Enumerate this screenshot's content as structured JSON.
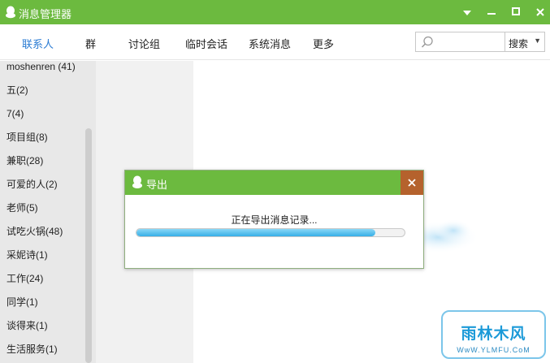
{
  "window": {
    "title": "消息管理器",
    "icons": [
      "qq-penguin-icon",
      "dropdown-icon",
      "minimize-icon",
      "maximize-icon",
      "close-icon"
    ]
  },
  "tabs": [
    {
      "label": "联系人",
      "active": true
    },
    {
      "label": "群"
    },
    {
      "label": "讨论组"
    },
    {
      "label": "临时会话"
    },
    {
      "label": "系统消息"
    },
    {
      "label": "更多"
    }
  ],
  "search": {
    "placeholder": "",
    "value": "",
    "button_label": "搜索"
  },
  "groups": [
    "moshenren (41)",
    "五(2)",
    "7(4)",
    "项目组(8)",
    "兼职(28)",
    "可爱的人(2)",
    "老师(5)",
    "试吃火锅(48)",
    "采妮诗(1)",
    "工作(24)",
    "同学(1)",
    "谈得来(1)",
    "生活服务(1)"
  ],
  "dialog": {
    "title": "导出",
    "status": "正在导出消息记录...",
    "progress_fraction": 0.89
  },
  "watermark": {
    "text": "雨林木风",
    "url": "WwW.YLMFU.CoM"
  },
  "colors": {
    "accent": "#6cba3f",
    "active_tab": "#2a7bd3",
    "close_button": "#b5622d",
    "progress": "#36aee6"
  }
}
